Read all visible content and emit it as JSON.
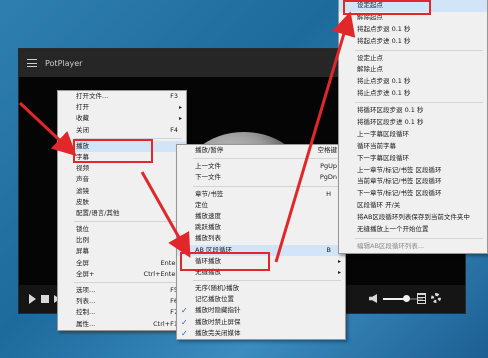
{
  "window": {
    "title": "PotPlayer"
  },
  "menu_main": [
    {
      "label": "打开文件...",
      "shortcut": "F3",
      "arrow": false
    },
    {
      "label": "打开",
      "shortcut": "",
      "arrow": true
    },
    {
      "label": "收藏",
      "shortcut": "",
      "arrow": true
    },
    {
      "label": "关闭",
      "shortcut": "F4",
      "arrow": false
    },
    {
      "sep": true
    },
    {
      "label": "播放",
      "shortcut": "",
      "arrow": true,
      "selected": true
    },
    {
      "label": "字幕",
      "shortcut": "",
      "arrow": true
    },
    {
      "label": "视频",
      "shortcut": "",
      "arrow": true
    },
    {
      "label": "声音",
      "shortcut": "",
      "arrow": true
    },
    {
      "label": "滤镜",
      "shortcut": "",
      "arrow": true
    },
    {
      "label": "皮肤",
      "shortcut": "",
      "arrow": true
    },
    {
      "label": "配置/语言/其他",
      "shortcut": "",
      "arrow": true
    },
    {
      "sep": true
    },
    {
      "label": "锁位",
      "shortcut": "",
      "arrow": false
    },
    {
      "label": "比例",
      "shortcut": "",
      "arrow": true
    },
    {
      "label": "屏幕",
      "shortcut": "",
      "arrow": true
    },
    {
      "label": "全屏",
      "shortcut": "Enter",
      "arrow": false
    },
    {
      "label": "全屏+",
      "shortcut": "Ctrl+Enter",
      "arrow": false
    },
    {
      "sep": true
    },
    {
      "label": "选项...",
      "shortcut": "F5",
      "arrow": false
    },
    {
      "label": "列表...",
      "shortcut": "F6",
      "arrow": false
    },
    {
      "label": "控制...",
      "shortcut": "F7",
      "arrow": false
    },
    {
      "label": "属性...",
      "shortcut": "Ctrl+F1",
      "arrow": false
    }
  ],
  "menu_play": [
    {
      "label": "播放/暂停",
      "shortcut": "空格键",
      "arrow": false
    },
    {
      "sep": true
    },
    {
      "label": "上一文件",
      "shortcut": "PgUp",
      "arrow": false
    },
    {
      "label": "下一文件",
      "shortcut": "PgDn",
      "arrow": false
    },
    {
      "sep": true
    },
    {
      "label": "章节/书签",
      "shortcut": "H",
      "arrow": true
    },
    {
      "label": "定位",
      "shortcut": "",
      "arrow": true
    },
    {
      "label": "播放速度",
      "shortcut": "",
      "arrow": true
    },
    {
      "label": "跳跃播放",
      "shortcut": "",
      "arrow": true
    },
    {
      "label": "播放列表",
      "shortcut": "",
      "arrow": true
    },
    {
      "label": "AB 区段循环",
      "shortcut": "B",
      "arrow": true,
      "selected": true
    },
    {
      "label": "循环播放",
      "shortcut": "",
      "arrow": true
    },
    {
      "label": "无缝播放",
      "shortcut": "",
      "arrow": true
    },
    {
      "sep": true
    },
    {
      "label": "无序(随机)播放",
      "shortcut": "",
      "arrow": false
    },
    {
      "label": "记忆播放位置",
      "shortcut": "",
      "arrow": false
    },
    {
      "label": "播放时隐藏指针",
      "shortcut": "",
      "arrow": false,
      "checked": true
    },
    {
      "label": "播放时禁止屏保",
      "shortcut": "",
      "arrow": false,
      "checked": true
    },
    {
      "label": "播放完关闭媒体",
      "shortcut": "",
      "arrow": false,
      "checked": true
    }
  ],
  "menu_ab": [
    {
      "label": "设定起点",
      "selected": true
    },
    {
      "label": "解除起点"
    },
    {
      "label": "将起点步退 0.1 秒"
    },
    {
      "label": "将起点步进 0.1 秒"
    },
    {
      "sep": true
    },
    {
      "label": "设定止点"
    },
    {
      "label": "解除止点"
    },
    {
      "label": "将止点步退 0.1 秒"
    },
    {
      "label": "将止点步进 0.1 秒"
    },
    {
      "sep": true
    },
    {
      "label": "将循环区段步退 0.1 秒"
    },
    {
      "label": "将循环区段步进 0.1 秒"
    },
    {
      "label": "上一字幕区段循环"
    },
    {
      "label": "循环当前字幕"
    },
    {
      "label": "下一字幕区段循环"
    },
    {
      "label": "上一章节/标记/书签 区段循环"
    },
    {
      "label": "当前章节/标记/书签 区段循环"
    },
    {
      "label": "下一章节/标记/书签 区段循环"
    },
    {
      "label": "区段循环 开/关"
    },
    {
      "label": "将AB区段循环列表保存到当前文件夹中"
    },
    {
      "label": "无缝播放上一个开始位置"
    },
    {
      "sep": true
    },
    {
      "label": "编辑AB区段循环列表...",
      "disabled": true
    }
  ],
  "colors": {
    "highlight_border": "#e0282a",
    "arrow": "#e0282a",
    "check": "#1c62c4"
  },
  "icons": [
    "menu-icon",
    "play-icon",
    "stop-icon",
    "next-icon",
    "volume-icon",
    "playlist-icon",
    "gear-icon",
    "check-icon",
    "chevron-right-icon"
  ]
}
